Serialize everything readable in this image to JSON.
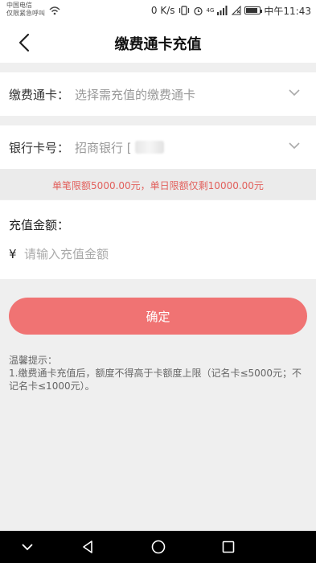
{
  "status_bar": {
    "carrier_line1": "中国电信",
    "carrier_line2": "仅限紧急呼叫",
    "network_speed": "0 K/s",
    "signal_label": "4G",
    "time": "中午11:43"
  },
  "nav": {
    "title": "缴费通卡充值"
  },
  "card_row": {
    "label": "缴费通卡：",
    "placeholder": "选择需充值的缴费通卡"
  },
  "bank_row": {
    "label": "银行卡号：",
    "value": "招商银行 ["
  },
  "limit": {
    "text": "单笔限额5000.00元，单日限额仅剩10000.00元"
  },
  "amount": {
    "label": "充值金额：",
    "currency_symbol": "¥",
    "placeholder": "请输入充值金额",
    "value": ""
  },
  "confirm": {
    "label": "确定"
  },
  "tips": {
    "title": "温馨提示：",
    "line1": "1.缴费通卡充值后，额度不得高于卡额度上限（记名卡≤5000元；不记名卡≤1000元）。"
  },
  "colors": {
    "accent": "#f07373",
    "warning_text": "#e2605c",
    "background": "#efefef"
  },
  "icons": {
    "back": "chevron-left-icon",
    "dropdown": "chevron-down-icon",
    "sys_nav": [
      "collapse-icon",
      "back-triangle-icon",
      "home-circle-icon",
      "recent-square-icon"
    ]
  }
}
